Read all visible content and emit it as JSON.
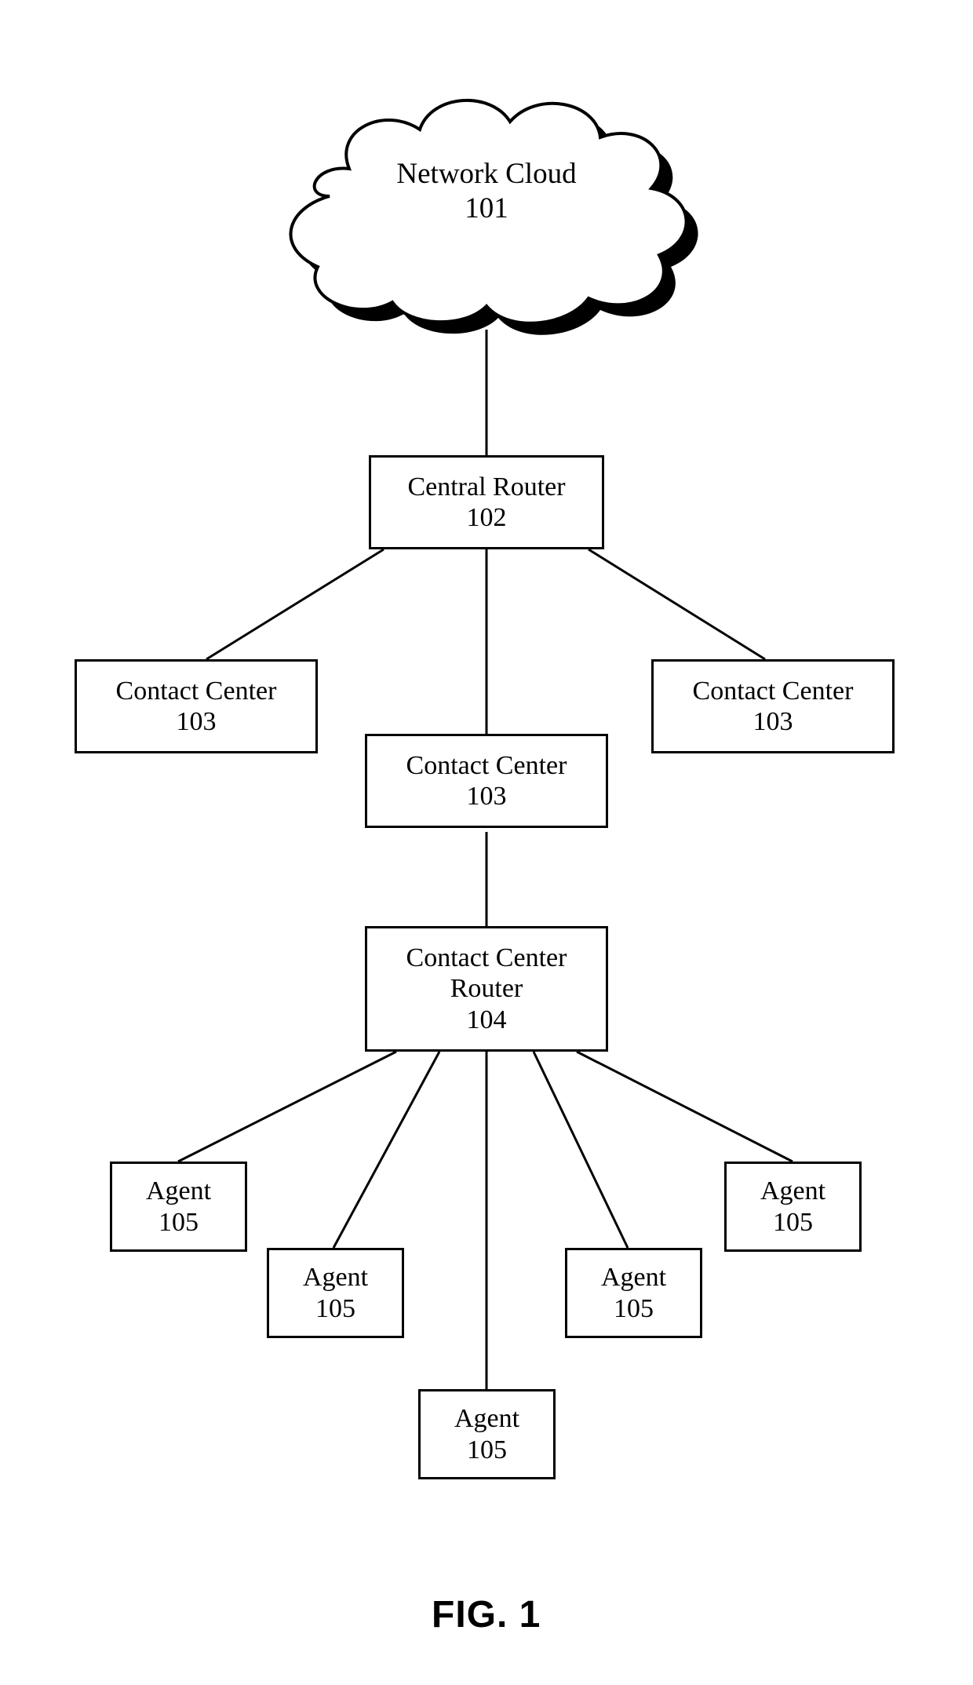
{
  "cloud": {
    "label": "Network Cloud",
    "num": "101"
  },
  "central_router": {
    "label": "Central Router",
    "num": "102"
  },
  "contact_center": {
    "left": {
      "label": "Contact Center",
      "num": "103"
    },
    "middle": {
      "label": "Contact Center",
      "num": "103"
    },
    "right": {
      "label": "Contact Center",
      "num": "103"
    }
  },
  "cc_router": {
    "line1": "Contact Center",
    "line2": "Router",
    "num": "104"
  },
  "agent": {
    "a": {
      "label": "Agent",
      "num": "105"
    },
    "b": {
      "label": "Agent",
      "num": "105"
    },
    "c": {
      "label": "Agent",
      "num": "105"
    },
    "d": {
      "label": "Agent",
      "num": "105"
    },
    "e": {
      "label": "Agent",
      "num": "105"
    }
  },
  "figure": "FIG. 1",
  "chart_data": {
    "type": "diagram",
    "nodes": [
      {
        "id": "cloud",
        "label": "Network Cloud",
        "ref": "101"
      },
      {
        "id": "central-router",
        "label": "Central Router",
        "ref": "102"
      },
      {
        "id": "cc-left",
        "label": "Contact Center",
        "ref": "103"
      },
      {
        "id": "cc-mid",
        "label": "Contact Center",
        "ref": "103"
      },
      {
        "id": "cc-right",
        "label": "Contact Center",
        "ref": "103"
      },
      {
        "id": "cc-router",
        "label": "Contact Center Router",
        "ref": "104"
      },
      {
        "id": "agent-a",
        "label": "Agent",
        "ref": "105"
      },
      {
        "id": "agent-b",
        "label": "Agent",
        "ref": "105"
      },
      {
        "id": "agent-c",
        "label": "Agent",
        "ref": "105"
      },
      {
        "id": "agent-d",
        "label": "Agent",
        "ref": "105"
      },
      {
        "id": "agent-e",
        "label": "Agent",
        "ref": "105"
      }
    ],
    "edges": [
      [
        "cloud",
        "central-router"
      ],
      [
        "central-router",
        "cc-left"
      ],
      [
        "central-router",
        "cc-mid"
      ],
      [
        "central-router",
        "cc-right"
      ],
      [
        "cc-mid",
        "cc-router"
      ],
      [
        "cc-router",
        "agent-a"
      ],
      [
        "cc-router",
        "agent-b"
      ],
      [
        "cc-router",
        "agent-c"
      ],
      [
        "cc-router",
        "agent-d"
      ],
      [
        "cc-router",
        "agent-e"
      ]
    ]
  }
}
